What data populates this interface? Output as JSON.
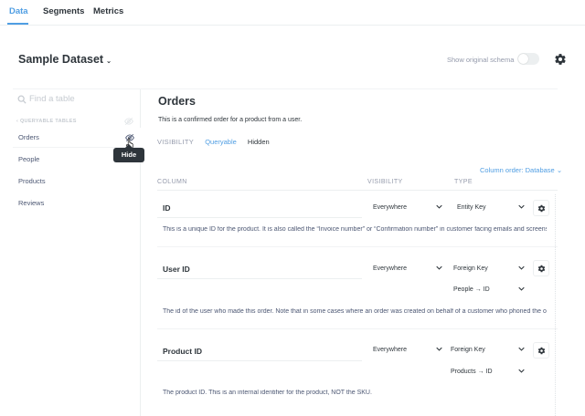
{
  "nav": {
    "tabs": [
      {
        "label": "Data"
      },
      {
        "label": "Segments"
      },
      {
        "label": "Metrics"
      }
    ]
  },
  "header": {
    "dataset": "Sample Dataset",
    "show_original_schema": "Show original schema",
    "toggle_on": false
  },
  "sidebar": {
    "search_placeholder": "Find a table",
    "section_title": "QUERYABLE TABLES",
    "items": [
      {
        "label": "Orders"
      },
      {
        "label": "People"
      },
      {
        "label": "Products"
      },
      {
        "label": "Reviews"
      }
    ],
    "tooltip": "Hide"
  },
  "table": {
    "name": "Orders",
    "description": "This is a confirmed order for a product from a user.",
    "visibility_label": "VISIBILITY",
    "visibility_options": [
      {
        "label": "Queryable",
        "selected": true
      },
      {
        "label": "Hidden",
        "selected": false
      }
    ],
    "column_order": "Column order: Database"
  },
  "columns_header": {
    "column": "COLUMN",
    "visibility": "VISIBILITY",
    "type": "TYPE"
  },
  "fields": [
    {
      "name": "ID",
      "visibility": "Everywhere",
      "type": "Entity Key",
      "target": "",
      "description": "This is a unique ID for the product. It is also called the “Invoice number” or “Confirmation number” in customer facing emails and screens."
    },
    {
      "name": "User ID",
      "visibility": "Everywhere",
      "type": "Foreign Key",
      "target": "People → ID",
      "description": "The id of the user who made this order. Note that in some cases where an order was created on behalf of a customer who phoned the order in, this might be the employee handling the request."
    },
    {
      "name": "Product ID",
      "visibility": "Everywhere",
      "type": "Foreign Key",
      "target": "Products → ID",
      "description": "The product ID. This is an internal identifier for the product, NOT the SKU."
    }
  ],
  "colors": {
    "accent": "#509ee3",
    "text": "#2e353b",
    "muted": "#949aab"
  }
}
